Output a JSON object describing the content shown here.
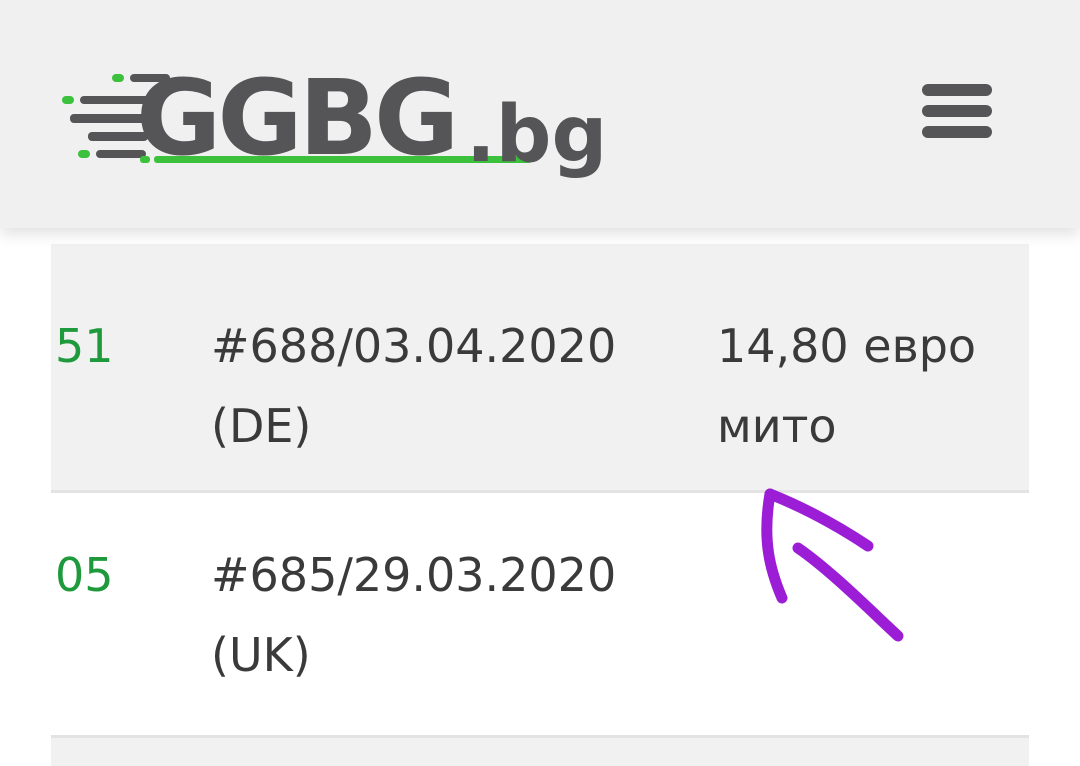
{
  "header": {
    "logo": {
      "main_text": "GGBG",
      "tld_text": ".bg",
      "colors": {
        "gray": "#555558",
        "green": "#3cc13c"
      }
    },
    "menu_icon": "hamburger-menu-icon"
  },
  "table": {
    "rows": [
      {
        "number": "51",
        "order_line1": "#688/03.04.2020",
        "order_line2": "(DE)",
        "note_line1": "14,80 евро",
        "note_line2": "мито",
        "shaded": true
      },
      {
        "number": "05",
        "order_line1": "#685/29.03.2020",
        "order_line2": "(UK)",
        "note_line1": "",
        "note_line2": "",
        "shaded": false
      },
      {
        "number": "",
        "order_line1": "",
        "order_line2": "",
        "note_line1": "",
        "note_line2": "",
        "shaded": true
      }
    ]
  },
  "annotation": {
    "color": "#9b1ed6",
    "shape": "hand-drawn-arrow"
  }
}
